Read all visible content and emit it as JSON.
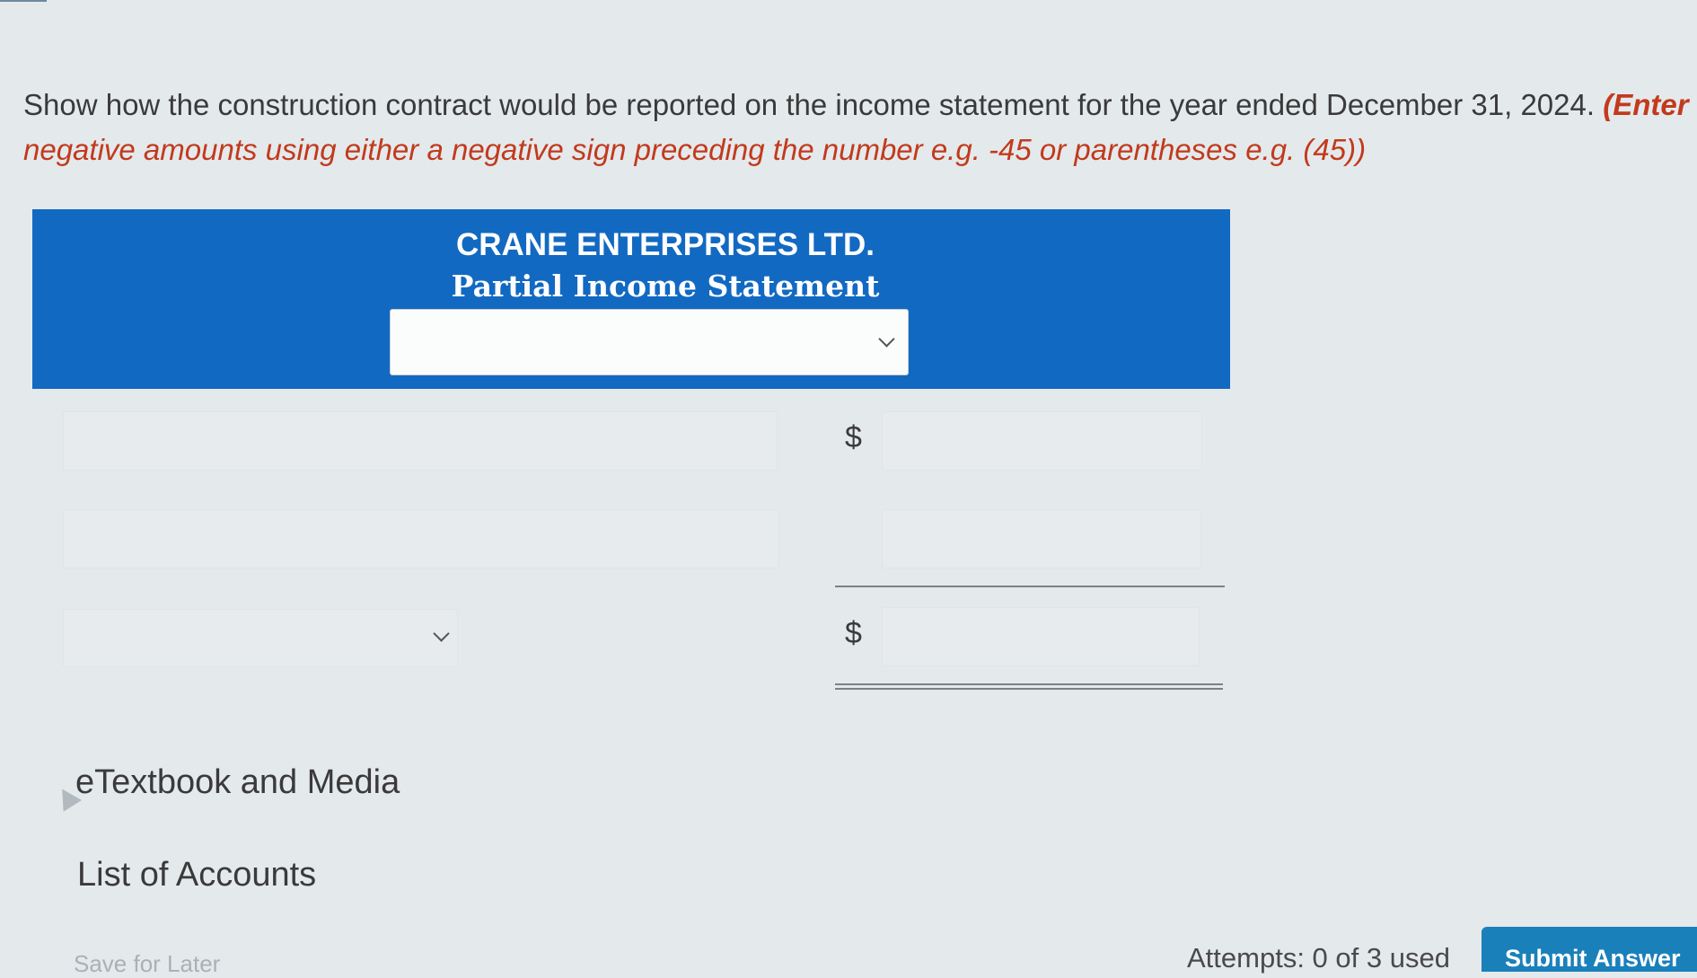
{
  "instructions": {
    "main": "Show how the construction contract would be reported on the income statement for the year ended December 31, 2024.",
    "enter": "(Enter",
    "note": "negative amounts using either a negative sign preceding the number e.g. -45 or parentheses e.g. (45))"
  },
  "statement": {
    "company": "CRANE ENTERPRISES LTD.",
    "title": "Partial Income Statement",
    "period_selected": ""
  },
  "rows": {
    "currency_symbol_1": "$",
    "currency_symbol_2": "$"
  },
  "links": {
    "etextbook": "eTextbook and Media",
    "accounts": "List of Accounts",
    "partial_below": "Save for Later"
  },
  "footer": {
    "attempts": "Attempts: 0 of 3 used",
    "submit": "Submit Answer"
  }
}
